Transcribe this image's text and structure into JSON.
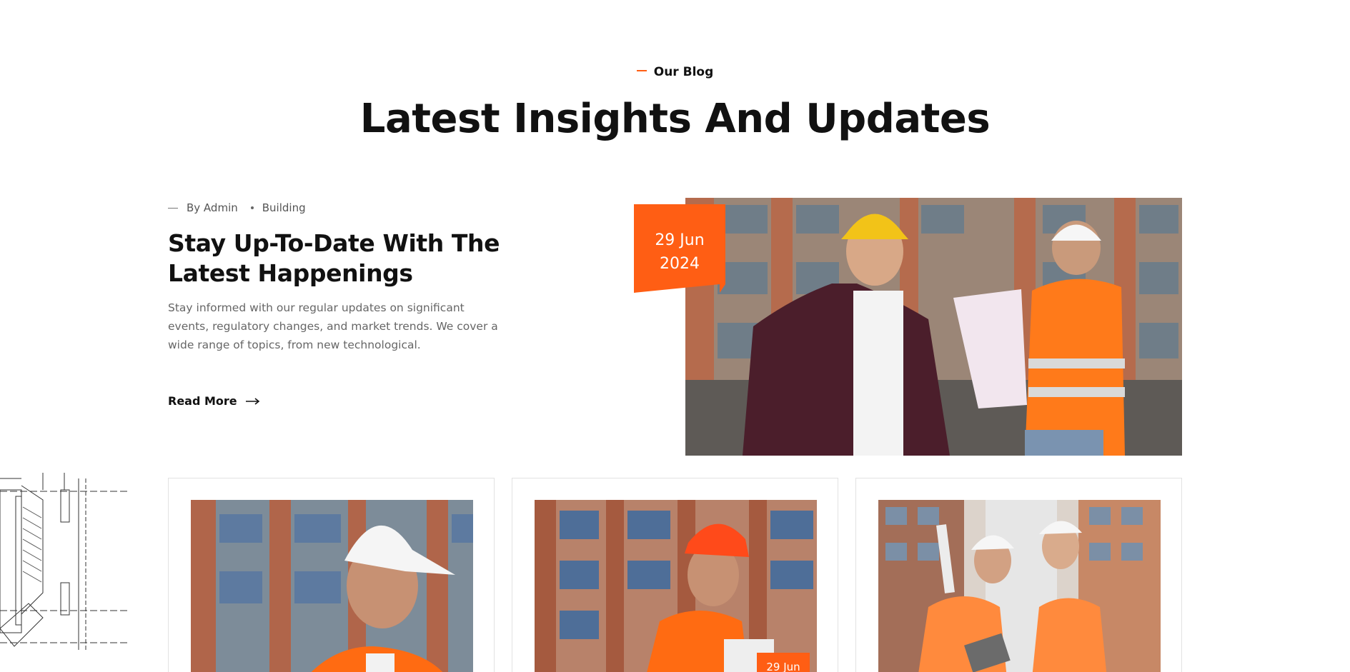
{
  "header": {
    "eyebrow": "Our Blog",
    "title": "Latest Insights And Updates"
  },
  "featured": {
    "author": "By Admin",
    "category": "Building",
    "title": "Stay Up-To-Date With The Latest Happenings",
    "excerpt": "Stay informed with our regular updates on significant events, regulatory changes, and market trends. We cover a wide range of topics, from new technological.",
    "read_more": "Read More",
    "date_day": "29 Jun",
    "date_year": "2024",
    "image_icon": "construction-workers-photo"
  },
  "cards": [
    {
      "image_icon": "worker-white-helmet-photo",
      "date": ""
    },
    {
      "image_icon": "worker-red-helmet-photo",
      "date": "29 Jun"
    },
    {
      "image_icon": "two-engineers-pointing-photo",
      "date": ""
    }
  ],
  "colors": {
    "accent": "#ff5e14",
    "heading": "#111111",
    "body_text": "#666666"
  }
}
